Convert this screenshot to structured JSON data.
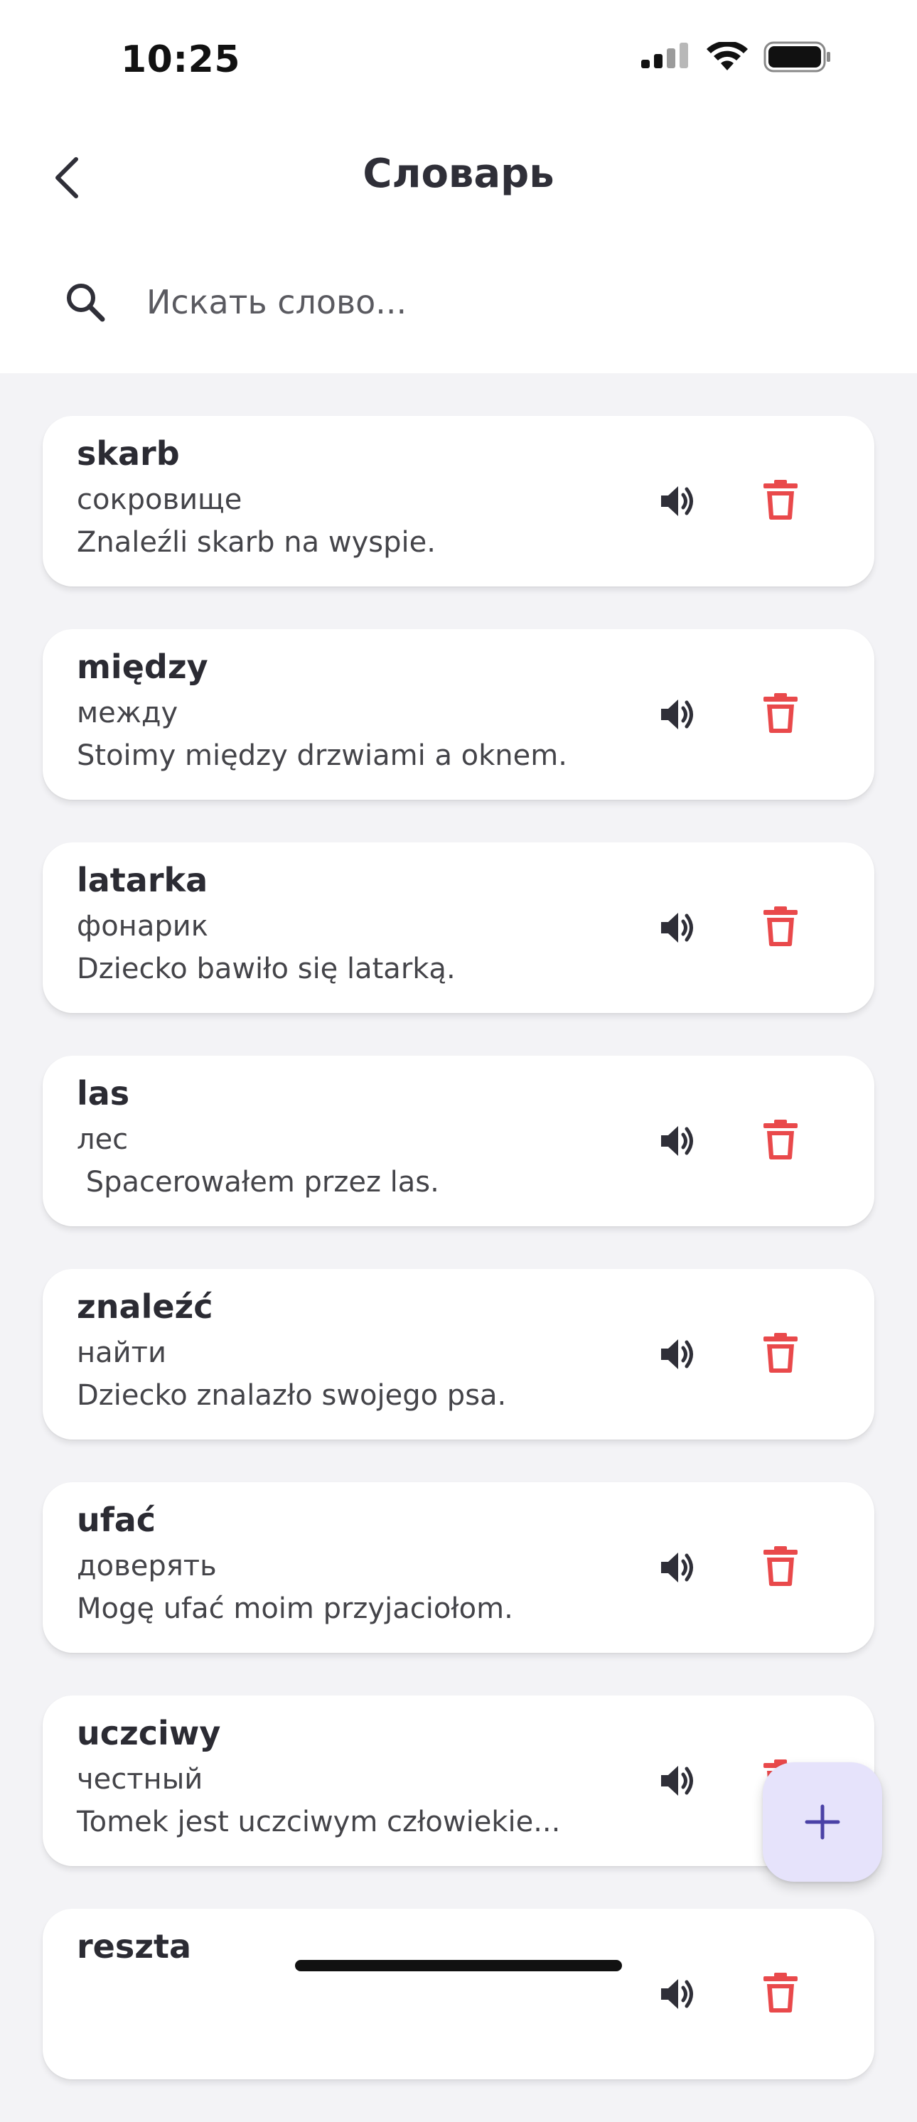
{
  "status_bar": {
    "time": "10:25"
  },
  "header": {
    "title": "Словарь"
  },
  "search": {
    "placeholder": "Искать слово..."
  },
  "colors": {
    "delete": "#e9494b",
    "fab_bg": "#e6e3fb",
    "accent": "#4a41a6"
  },
  "icons": {
    "back": "chevron-left-icon",
    "search": "search-icon",
    "speaker": "speaker-icon",
    "delete": "trash-icon",
    "add": "plus-icon"
  },
  "words": [
    {
      "word": "skarb",
      "translation": "сокровище",
      "example": "Znaleźli skarb na wyspie."
    },
    {
      "word": "między",
      "translation": "между",
      "example": "Stoimy między drzwiami a oknem."
    },
    {
      "word": "latarka",
      "translation": "фонарик",
      "example": "Dziecko bawiło się latarką."
    },
    {
      "word": "las",
      "translation": "лес",
      "example": " Spacerowałem przez las."
    },
    {
      "word": "znaleźć",
      "translation": "найти",
      "example": "Dziecko znalazło swojego psa."
    },
    {
      "word": "ufać",
      "translation": "доверять",
      "example": "Mogę ufać moim przyjaciołom."
    },
    {
      "word": "uczciwy",
      "translation": "честный",
      "example": "Tomek jest uczciwym człowiekie..."
    },
    {
      "word": "reszta",
      "translation": "",
      "example": ""
    }
  ]
}
